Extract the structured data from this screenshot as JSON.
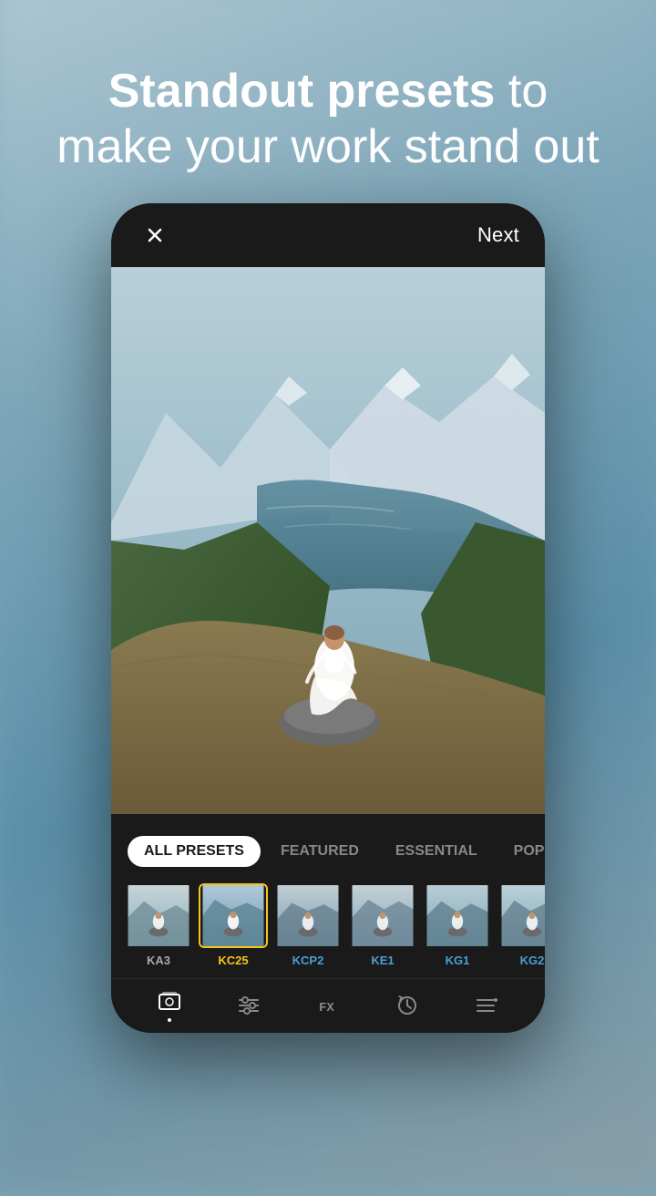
{
  "background": {
    "color": "#7ba8b8"
  },
  "headline": {
    "line1_bold": "Standout presets",
    "line1_normal": " to",
    "line2": "make your work stand out"
  },
  "topbar": {
    "next_label": "Next",
    "close_label": "Close"
  },
  "preset_tabs": [
    {
      "id": "all",
      "label": "ALL PRESETS",
      "active": true
    },
    {
      "id": "featured",
      "label": "FEATURED",
      "active": false
    },
    {
      "id": "essential",
      "label": "ESSENTIAL",
      "active": false
    },
    {
      "id": "popular",
      "label": "POPU...",
      "active": false
    }
  ],
  "preset_items": [
    {
      "id": "ka3",
      "label": "KA3",
      "selected": false,
      "label_color": "normal"
    },
    {
      "id": "kc25",
      "label": "KC25",
      "selected": true,
      "label_color": "yellow"
    },
    {
      "id": "kcp2",
      "label": "KCP2",
      "selected": false,
      "label_color": "blue"
    },
    {
      "id": "ke1",
      "label": "KE1",
      "selected": false,
      "label_color": "blue"
    },
    {
      "id": "kg1",
      "label": "KG1",
      "selected": false,
      "label_color": "blue"
    },
    {
      "id": "kg2",
      "label": "KG2",
      "selected": false,
      "label_color": "blue"
    }
  ],
  "tools": [
    {
      "id": "photos",
      "label": "Photos",
      "active": true
    },
    {
      "id": "adjustments",
      "label": "Adjustments",
      "active": false
    },
    {
      "id": "fx",
      "label": "FX",
      "active": false
    },
    {
      "id": "history",
      "label": "History",
      "active": false
    },
    {
      "id": "menu",
      "label": "Menu",
      "active": false
    }
  ]
}
